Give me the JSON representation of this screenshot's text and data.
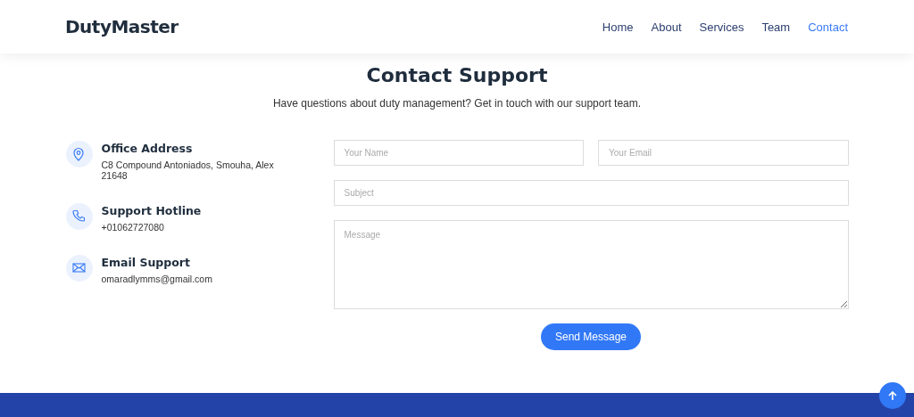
{
  "header": {
    "logo": "DutyMaster",
    "nav": [
      {
        "label": "Home",
        "selected": false
      },
      {
        "label": "About",
        "selected": false
      },
      {
        "label": "Services",
        "selected": false
      },
      {
        "label": "Team",
        "selected": false
      },
      {
        "label": "Contact",
        "selected": true
      }
    ]
  },
  "section": {
    "title": "Contact Support",
    "subtitle": "Have questions about duty management? Get in touch with our support team."
  },
  "contact_info": [
    {
      "kind": "location",
      "title": "Office Address",
      "text": "C8 Compound Antoniados, Smouha, Alex 21648"
    },
    {
      "kind": "phone",
      "title": "Support Hotline",
      "text": "+01062727080"
    },
    {
      "kind": "email",
      "title": "Email Support",
      "text": "omaradlymms@gmail.com"
    }
  ],
  "form": {
    "name": {
      "placeholder": "Your Name"
    },
    "email": {
      "placeholder": "Your Email"
    },
    "subject": {
      "placeholder": "Subject"
    },
    "message": {
      "placeholder": "Message"
    },
    "submit": "Send Message"
  }
}
